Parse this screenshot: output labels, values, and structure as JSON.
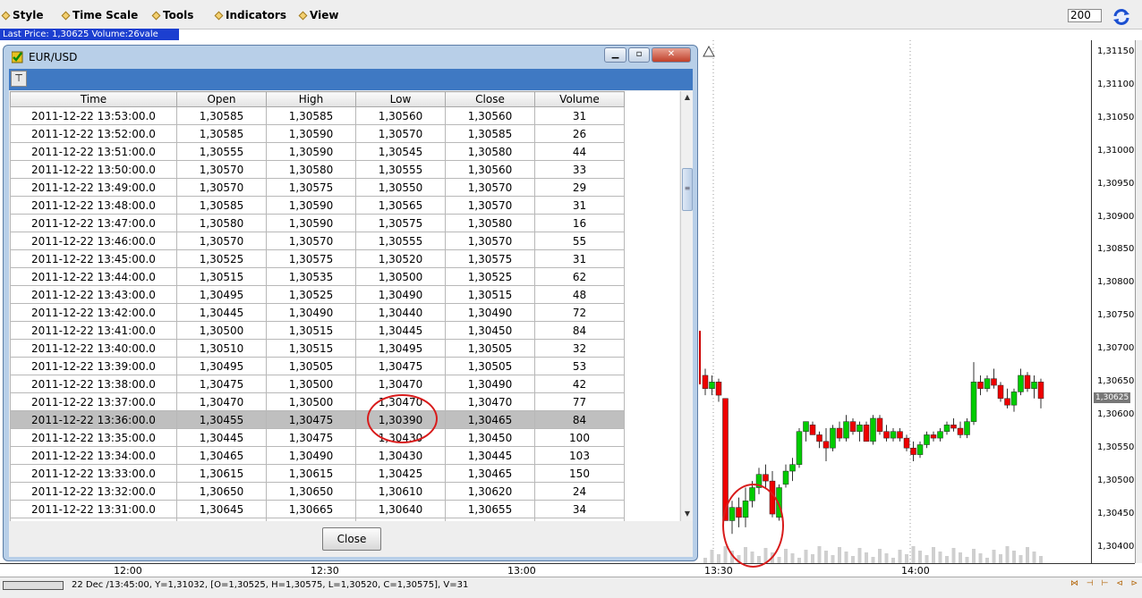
{
  "menu": {
    "items": [
      "Style",
      "Time Scale",
      "Tools",
      "Indicators",
      "View"
    ],
    "zoom_value": "200"
  },
  "last_price": "Last Price: 1,30625 Volume:26vale",
  "window": {
    "title": "EUR/USD",
    "columns": [
      "Time",
      "Open",
      "High",
      "Low",
      "Close",
      "Volume"
    ],
    "rows": [
      [
        "2011-12-22 13:53:00.0",
        "1,30585",
        "1,30585",
        "1,30560",
        "1,30560",
        "31"
      ],
      [
        "2011-12-22 13:52:00.0",
        "1,30585",
        "1,30590",
        "1,30570",
        "1,30585",
        "26"
      ],
      [
        "2011-12-22 13:51:00.0",
        "1,30555",
        "1,30590",
        "1,30545",
        "1,30580",
        "44"
      ],
      [
        "2011-12-22 13:50:00.0",
        "1,30570",
        "1,30580",
        "1,30555",
        "1,30560",
        "33"
      ],
      [
        "2011-12-22 13:49:00.0",
        "1,30570",
        "1,30575",
        "1,30550",
        "1,30570",
        "29"
      ],
      [
        "2011-12-22 13:48:00.0",
        "1,30585",
        "1,30590",
        "1,30565",
        "1,30570",
        "31"
      ],
      [
        "2011-12-22 13:47:00.0",
        "1,30580",
        "1,30590",
        "1,30575",
        "1,30580",
        "16"
      ],
      [
        "2011-12-22 13:46:00.0",
        "1,30570",
        "1,30570",
        "1,30555",
        "1,30570",
        "55"
      ],
      [
        "2011-12-22 13:45:00.0",
        "1,30525",
        "1,30575",
        "1,30520",
        "1,30575",
        "31"
      ],
      [
        "2011-12-22 13:44:00.0",
        "1,30515",
        "1,30535",
        "1,30500",
        "1,30525",
        "62"
      ],
      [
        "2011-12-22 13:43:00.0",
        "1,30495",
        "1,30525",
        "1,30490",
        "1,30515",
        "48"
      ],
      [
        "2011-12-22 13:42:00.0",
        "1,30445",
        "1,30490",
        "1,30440",
        "1,30490",
        "72"
      ],
      [
        "2011-12-22 13:41:00.0",
        "1,30500",
        "1,30515",
        "1,30445",
        "1,30450",
        "84"
      ],
      [
        "2011-12-22 13:40:00.0",
        "1,30510",
        "1,30515",
        "1,30495",
        "1,30505",
        "32"
      ],
      [
        "2011-12-22 13:39:00.0",
        "1,30495",
        "1,30505",
        "1,30475",
        "1,30505",
        "53"
      ],
      [
        "2011-12-22 13:38:00.0",
        "1,30475",
        "1,30500",
        "1,30470",
        "1,30490",
        "42"
      ],
      [
        "2011-12-22 13:37:00.0",
        "1,30470",
        "1,30500",
        "1,30470",
        "1,30470",
        "77"
      ],
      [
        "2011-12-22 13:36:00.0",
        "1,30455",
        "1,30475",
        "1,30390",
        "1,30465",
        "84"
      ],
      [
        "2011-12-22 13:35:00.0",
        "1,30445",
        "1,30475",
        "1,30430",
        "1,30450",
        "100"
      ],
      [
        "2011-12-22 13:34:00.0",
        "1,30465",
        "1,30490",
        "1,30430",
        "1,30445",
        "103"
      ],
      [
        "2011-12-22 13:33:00.0",
        "1,30615",
        "1,30615",
        "1,30425",
        "1,30465",
        "150"
      ],
      [
        "2011-12-22 13:32:00.0",
        "1,30650",
        "1,30650",
        "1,30610",
        "1,30620",
        "24"
      ],
      [
        "2011-12-22 13:31:00.0",
        "1,30645",
        "1,30665",
        "1,30640",
        "1,30655",
        "34"
      ]
    ],
    "selected_row": 17,
    "close_label": "Close"
  },
  "chart": {
    "price_labels": [
      "1,31150",
      "1,31100",
      "1,31050",
      "1,31000",
      "1,30950",
      "1,30900",
      "1,30850",
      "1,30800",
      "1,30750",
      "1,30700",
      "1,30650",
      "1,30600",
      "1,30550",
      "1,30500",
      "1,30450",
      "1,30400"
    ],
    "current_price": "1,30625",
    "time_labels": [
      "12:00",
      "12:30",
      "13:00",
      "13:30",
      "14:00"
    ],
    "up_color": "#00cc00",
    "down_color": "#ee0000"
  },
  "status": {
    "text": "22 Dec /13:45:00, Y=1,31032, [O=1,30525, H=1,30575, L=1,30520, C=1,30575], V=31"
  }
}
